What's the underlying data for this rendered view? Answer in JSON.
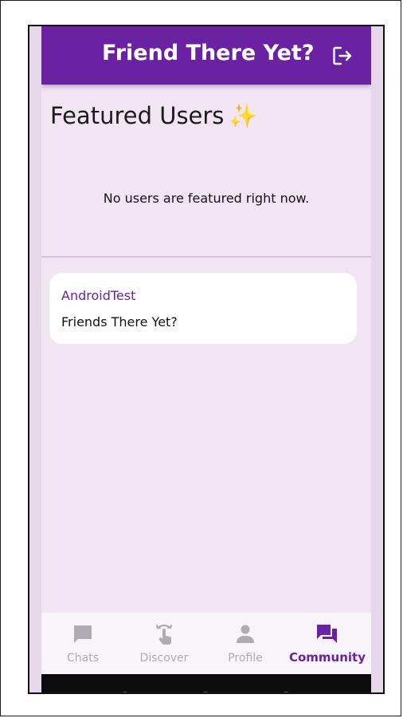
{
  "app_bar": {
    "title": "Friend There Yet?"
  },
  "featured": {
    "heading": "Featured Users",
    "heading_emoji": "✨",
    "empty_message": "No users are featured right now."
  },
  "posts": [
    {
      "author": "AndroidTest",
      "text": "Friends There Yet?"
    }
  ],
  "bottom_nav": {
    "items": [
      {
        "label": "Chats",
        "icon": "chat-icon",
        "active": false
      },
      {
        "label": "Discover",
        "icon": "swipe-icon",
        "active": false
      },
      {
        "label": "Profile",
        "icon": "person-icon",
        "active": false
      },
      {
        "label": "Community",
        "icon": "forum-icon",
        "active": true
      }
    ]
  },
  "colors": {
    "primary": "#6a22a2",
    "background": "#f1e5f3",
    "inactive": "#b0aab3"
  }
}
